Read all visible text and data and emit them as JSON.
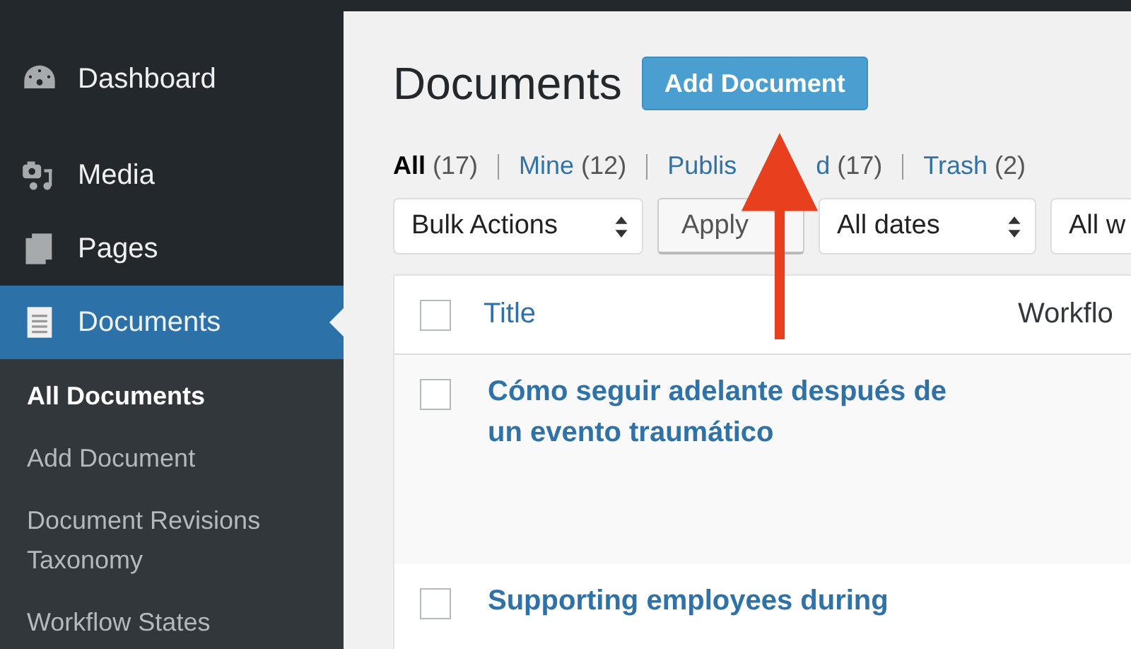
{
  "sidebar": {
    "items": [
      {
        "label": "Dashboard",
        "selected": false
      },
      {
        "label": "Media",
        "selected": false
      },
      {
        "label": "Pages",
        "selected": false
      },
      {
        "label": "Documents",
        "selected": true
      }
    ],
    "submenu": [
      {
        "label": "All Documents",
        "selected": true
      },
      {
        "label": "Add Document",
        "selected": false
      },
      {
        "label": "Document Revisions Taxonomy",
        "selected": false
      },
      {
        "label": "Workflow States",
        "selected": false
      }
    ]
  },
  "page_title": "Documents",
  "add_button": "Add Document",
  "filters": [
    {
      "label": "All",
      "count": "(17)",
      "selected": true
    },
    {
      "label": "Mine",
      "count": "(12)",
      "selected": false
    },
    {
      "label": "Publis",
      "label_after_arrow": "d",
      "count": "(17)",
      "selected": false
    },
    {
      "label": "Trash",
      "count": "(2)",
      "selected": false
    }
  ],
  "toolbar": {
    "bulk_actions": "Bulk Actions",
    "apply": "Apply",
    "dates": "All dates",
    "column_4": "All w"
  },
  "table": {
    "columns": [
      "Title",
      "Workflo"
    ],
    "select_all_checked": false,
    "rows": [
      {
        "title": "Cómo seguir adelante después de un evento traumático",
        "checked": false
      },
      {
        "title": "Supporting employees during",
        "checked": false
      }
    ]
  }
}
